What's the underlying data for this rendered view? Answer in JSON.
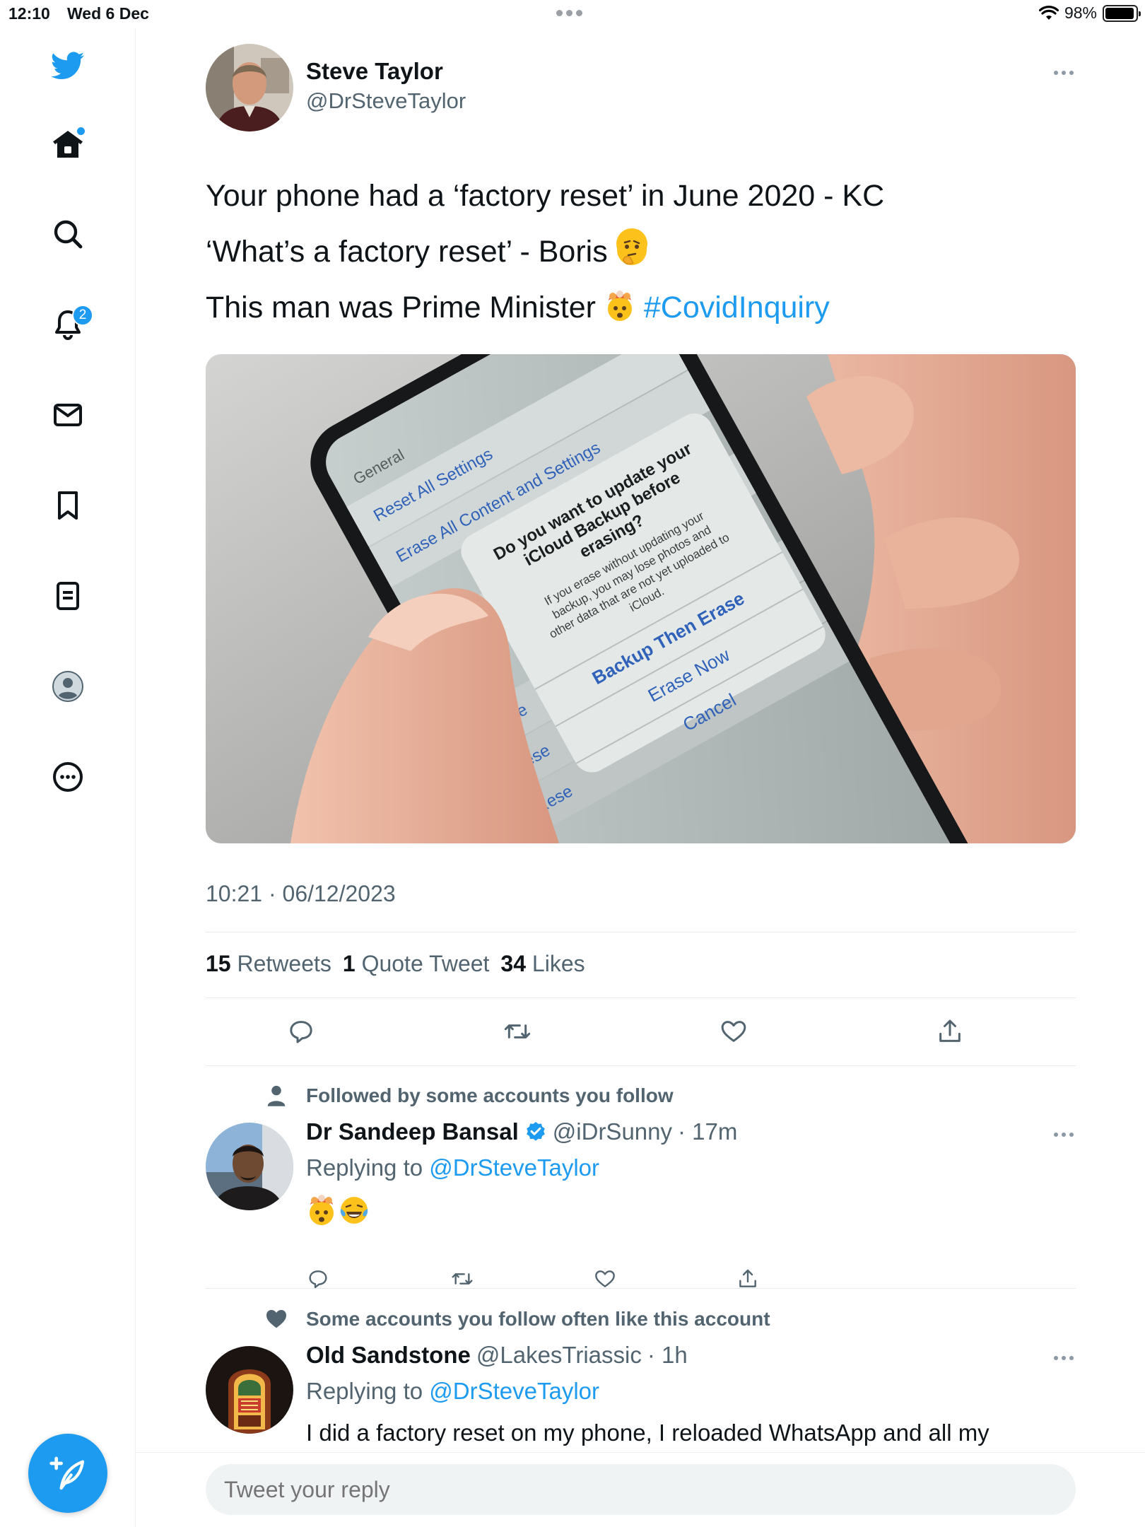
{
  "status_bar": {
    "time": "12:10",
    "date": "Wed 6 Dec",
    "battery": "98%"
  },
  "sidebar": {
    "items": [
      {
        "name": "twitter-logo"
      },
      {
        "name": "home"
      },
      {
        "name": "search"
      },
      {
        "name": "notifications",
        "badge": "2"
      },
      {
        "name": "messages"
      },
      {
        "name": "bookmarks"
      },
      {
        "name": "lists"
      },
      {
        "name": "profile"
      },
      {
        "name": "more"
      }
    ]
  },
  "tweet": {
    "author_name": "Steve Taylor",
    "author_handle": "@DrSteveTaylor",
    "text_lines": [
      "Your phone had a ‘factory reset’ in June 2020 - KC",
      "‘What’s a factory reset’ - Boris",
      "This man was Prime Minister"
    ],
    "emoji_line2": "thinking-face",
    "emoji_line3": "exploding-head",
    "hashtag": "#CovidInquiry",
    "media": {
      "back": "General",
      "row1": "Reset All Settings",
      "row2": "Erase All Content and Settings",
      "row_stub": "Rese",
      "dialog_title": "Do you want to update your iCloud Backup before erasing?",
      "dialog_body": "If you erase without updating your backup, you may lose photos and other data that are not yet uploaded to iCloud.",
      "btn1": "Backup Then Erase",
      "btn2": "Erase Now",
      "btn3": "Cancel"
    },
    "timestamp": "10:21 · 06/12/2023",
    "stats": {
      "retweets_num": "15",
      "retweets_label": "Retweets",
      "quotes_num": "1",
      "quotes_label": "Quote Tweet",
      "likes_num": "34",
      "likes_label": "Likes"
    }
  },
  "replies": [
    {
      "social_context": "Followed by some accounts you follow",
      "name": "Dr Sandeep Bansal",
      "verified": true,
      "handle": "@iDrSunny",
      "time": "· 17m",
      "replying_label": "Replying to",
      "replying_handle": "@DrSteveTaylor",
      "text": "",
      "emojis": [
        "exploding-head",
        "tears-of-joy"
      ]
    },
    {
      "social_context": "Some accounts you follow often like this account",
      "name": "Old Sandstone",
      "verified": false,
      "handle": "@LakesTriassic",
      "time": "· 1h",
      "replying_label": "Replying to",
      "replying_handle": "@DrSteveTaylor",
      "text": "I did a factory reset on my phone, I reloaded WhatsApp and all my"
    }
  ],
  "reply_bar": {
    "placeholder": "Tweet your reply"
  },
  "colors": {
    "accent": "#1d9bf0",
    "text": "#0f1419",
    "muted": "#536471",
    "divider": "#e7ebee"
  }
}
